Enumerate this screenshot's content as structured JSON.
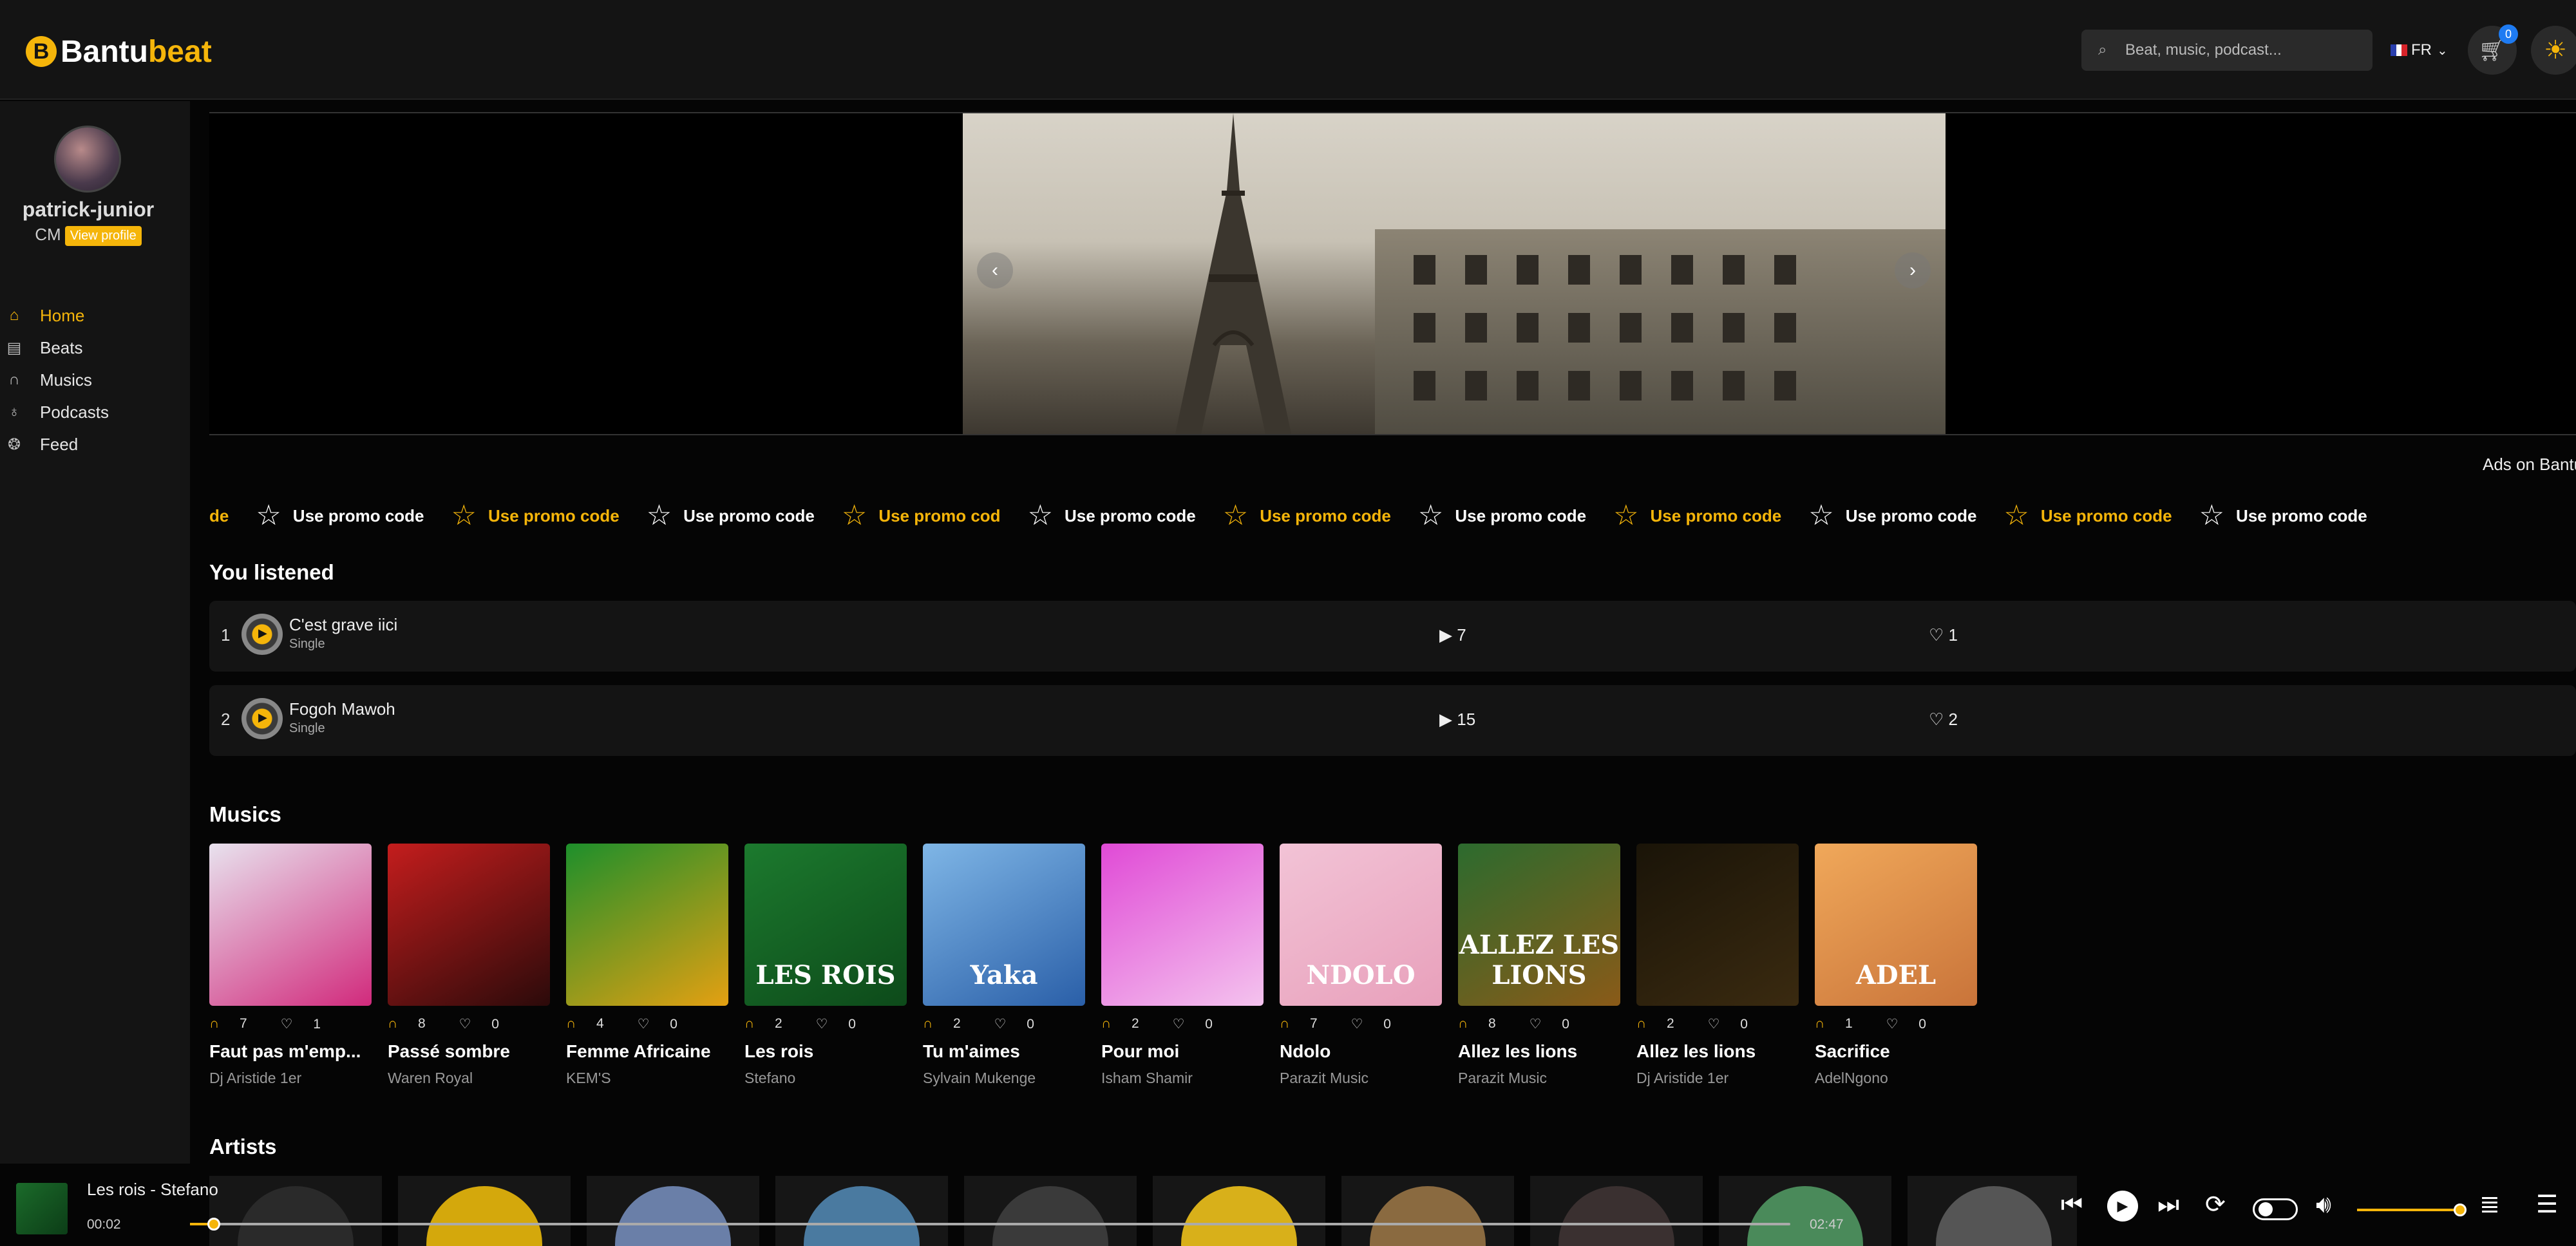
{
  "header": {
    "logo_part1": "Bantu",
    "logo_part2": "beat",
    "logo_mark": "B",
    "search_placeholder": "Beat, music, podcast...",
    "lang": "FR",
    "cart_count": "0"
  },
  "sidebar": {
    "username": "patrick-junior",
    "country": "CM",
    "view_profile": "View profile",
    "items": [
      {
        "label": "Home",
        "icon": "home-icon",
        "active": true
      },
      {
        "label": "Beats",
        "icon": "beats-icon"
      },
      {
        "label": "Musics",
        "icon": "headphones-icon"
      },
      {
        "label": "Podcasts",
        "icon": "podcast-icon"
      },
      {
        "label": "Feed",
        "icon": "feed-icon"
      }
    ]
  },
  "banner": {
    "ads_label": "Ads on Bantu"
  },
  "promo": {
    "items": [
      {
        "text": "de",
        "style": "y"
      },
      {
        "text": "Use promo code",
        "style": "w"
      },
      {
        "text": "Use promo code",
        "style": "y"
      },
      {
        "text": "Use promo code",
        "style": "w"
      },
      {
        "text": "Use promo cod",
        "style": "y"
      },
      {
        "text": "Use promo code",
        "style": "w"
      },
      {
        "text": "Use promo code",
        "style": "y"
      },
      {
        "text": "Use promo code",
        "style": "w"
      },
      {
        "text": "Use promo code",
        "style": "y"
      },
      {
        "text": "Use promo code",
        "style": "w"
      },
      {
        "text": "Use promo code",
        "style": "y"
      },
      {
        "text": "Use promo code",
        "style": "w"
      }
    ]
  },
  "listened": {
    "title": "You listened",
    "rows": [
      {
        "rank": "1",
        "title": "C'est grave iici",
        "kind": "Single",
        "plays": "7",
        "likes": "1"
      },
      {
        "rank": "2",
        "title": "Fogoh Mawoh",
        "kind": "Single",
        "plays": "15",
        "likes": "2"
      }
    ]
  },
  "musics": {
    "title": "Musics",
    "items": [
      {
        "listens": "7",
        "likes": "1",
        "name": "Faut pas m'emp...",
        "artist": "Dj Aristide 1er",
        "c1": "#e8e2ee",
        "c2": "#d12a7c",
        "cap": ""
      },
      {
        "listens": "8",
        "likes": "0",
        "name": "Passé sombre",
        "artist": "Waren Royal",
        "c1": "#c41d1d",
        "c2": "#2b0a0a",
        "cap": ""
      },
      {
        "listens": "4",
        "likes": "0",
        "name": "Femme Africaine",
        "artist": "KEM'S",
        "c1": "#1d8f2b",
        "c2": "#e4a012",
        "cap": ""
      },
      {
        "listens": "2",
        "likes": "0",
        "name": "Les rois",
        "artist": "Stefano",
        "c1": "#1c7a2e",
        "c2": "#0d4a1a",
        "cap": "LES ROIS"
      },
      {
        "listens": "2",
        "likes": "0",
        "name": "Tu m'aimes",
        "artist": "Sylvain Mukenge",
        "c1": "#7fb6e6",
        "c2": "#2a5fa8",
        "cap": "Yaka"
      },
      {
        "listens": "2",
        "likes": "0",
        "name": "Pour moi",
        "artist": "Isham Shamir",
        "c1": "#e04ad6",
        "c2": "#f4c3ee",
        "cap": ""
      },
      {
        "listens": "7",
        "likes": "0",
        "name": "Ndolo",
        "artist": "Parazit Music",
        "c1": "#f2c3d6",
        "c2": "#e8a0bb",
        "cap": "NDOLO"
      },
      {
        "listens": "8",
        "likes": "0",
        "name": "Allez les lions",
        "artist": "Parazit Music",
        "c1": "#2c6b2e",
        "c2": "#8a5a18",
        "cap": "ALLEZ LES LIONS"
      },
      {
        "listens": "2",
        "likes": "0",
        "name": "Allez les lions",
        "artist": "Dj Aristide 1er",
        "c1": "#1a1408",
        "c2": "#3a2a10",
        "cap": ""
      },
      {
        "listens": "1",
        "likes": "0",
        "name": "Sacrifice",
        "artist": "AdelNgono",
        "c1": "#f0a85a",
        "c2": "#c9743a",
        "cap": "ADEL"
      }
    ]
  },
  "artists": {
    "title": "Artists",
    "tiles": [
      "#2a2a2a",
      "#d4a80c",
      "#6a7fa8",
      "#4a7aa0",
      "#3a3a3a",
      "#d8b01a",
      "#8a6a40",
      "#3a3030",
      "#4a8a5a",
      "#555555"
    ]
  },
  "player": {
    "title": "Les rois - Stefano",
    "elapsed": "00:02",
    "duration": "02:47",
    "progress": 0.015,
    "volume": 1.0
  },
  "colors": {
    "accent": "#f5b50a",
    "background": "#050505",
    "panel": "#141414"
  }
}
